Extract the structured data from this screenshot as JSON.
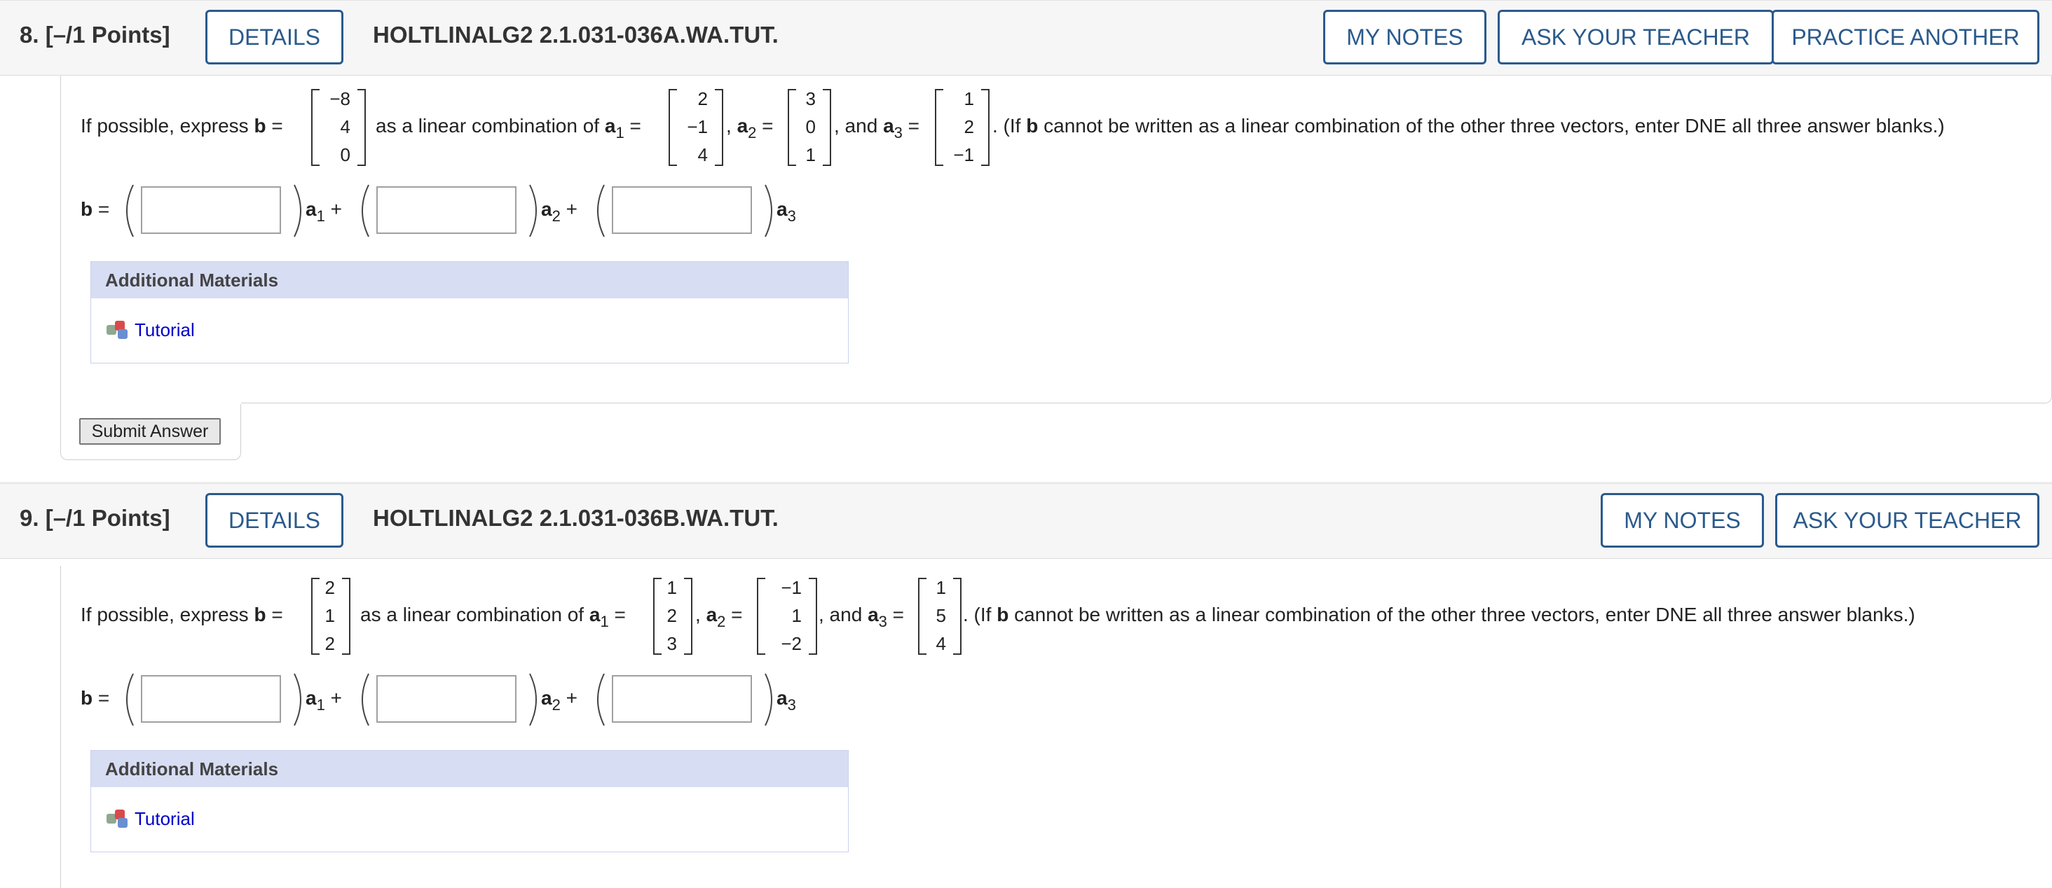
{
  "q8": {
    "number": "8.",
    "points": "[–/1 Points]",
    "details": "DETAILS",
    "code": "HOLTLINALG2 2.1.031-036A.WA.TUT.",
    "my_notes": "MY NOTES",
    "ask_teacher": "ASK YOUR TEACHER",
    "practice": "PRACTICE ANOTHER",
    "prompt_start": "If possible, express",
    "b": "b",
    "eq": "=",
    "b_vec": [
      "−8",
      "4",
      "0"
    ],
    "as_lin": "as a linear combination of",
    "a": "a",
    "s1": "1",
    "s2": "2",
    "s3": "3",
    "a1_vec": [
      "2",
      "−1",
      "4"
    ],
    "comma": ",",
    "a2_vec": [
      "3",
      "0",
      "1"
    ],
    "and": ", and",
    "a3_vec": [
      "1",
      "2",
      "−1"
    ],
    "suffix_1": ". (If",
    "suffix_2": "cannot be written as a linear combination of the other three vectors, enter DNE all three answer blanks.)",
    "plus": "+",
    "answers": [
      "",
      "",
      ""
    ],
    "am_title": "Additional Materials",
    "tutorial": "Tutorial",
    "submit": "Submit Answer"
  },
  "q9": {
    "number": "9.",
    "points": "[–/1 Points]",
    "details": "DETAILS",
    "code": "HOLTLINALG2 2.1.031-036B.WA.TUT.",
    "my_notes": "MY NOTES",
    "ask_teacher": "ASK YOUR TEACHER",
    "prompt_start": "If possible, express",
    "b": "b",
    "eq": "=",
    "b_vec": [
      "2",
      "1",
      "2"
    ],
    "as_lin": "as a linear combination of",
    "a": "a",
    "s1": "1",
    "s2": "2",
    "s3": "3",
    "a1_vec": [
      "1",
      "2",
      "3"
    ],
    "comma": ",",
    "a2_vec": [
      "−1",
      "1",
      "−2"
    ],
    "and": ", and",
    "a3_vec": [
      "1",
      "5",
      "4"
    ],
    "suffix_1": ". (If",
    "suffix_2": "cannot be written as a linear combination of the other three vectors, enter DNE all three answer blanks.)",
    "plus": "+",
    "answers": [
      "",
      "",
      ""
    ],
    "am_title": "Additional Materials",
    "tutorial": "Tutorial"
  },
  "colors": {
    "header_bg": "#f6f6f6",
    "button_blue": "#2a5a8c",
    "materials_bg": "#d7ddf3",
    "link": "#0000cc"
  },
  "icons": {
    "tutorial": "tutorial-cubes-icon"
  }
}
